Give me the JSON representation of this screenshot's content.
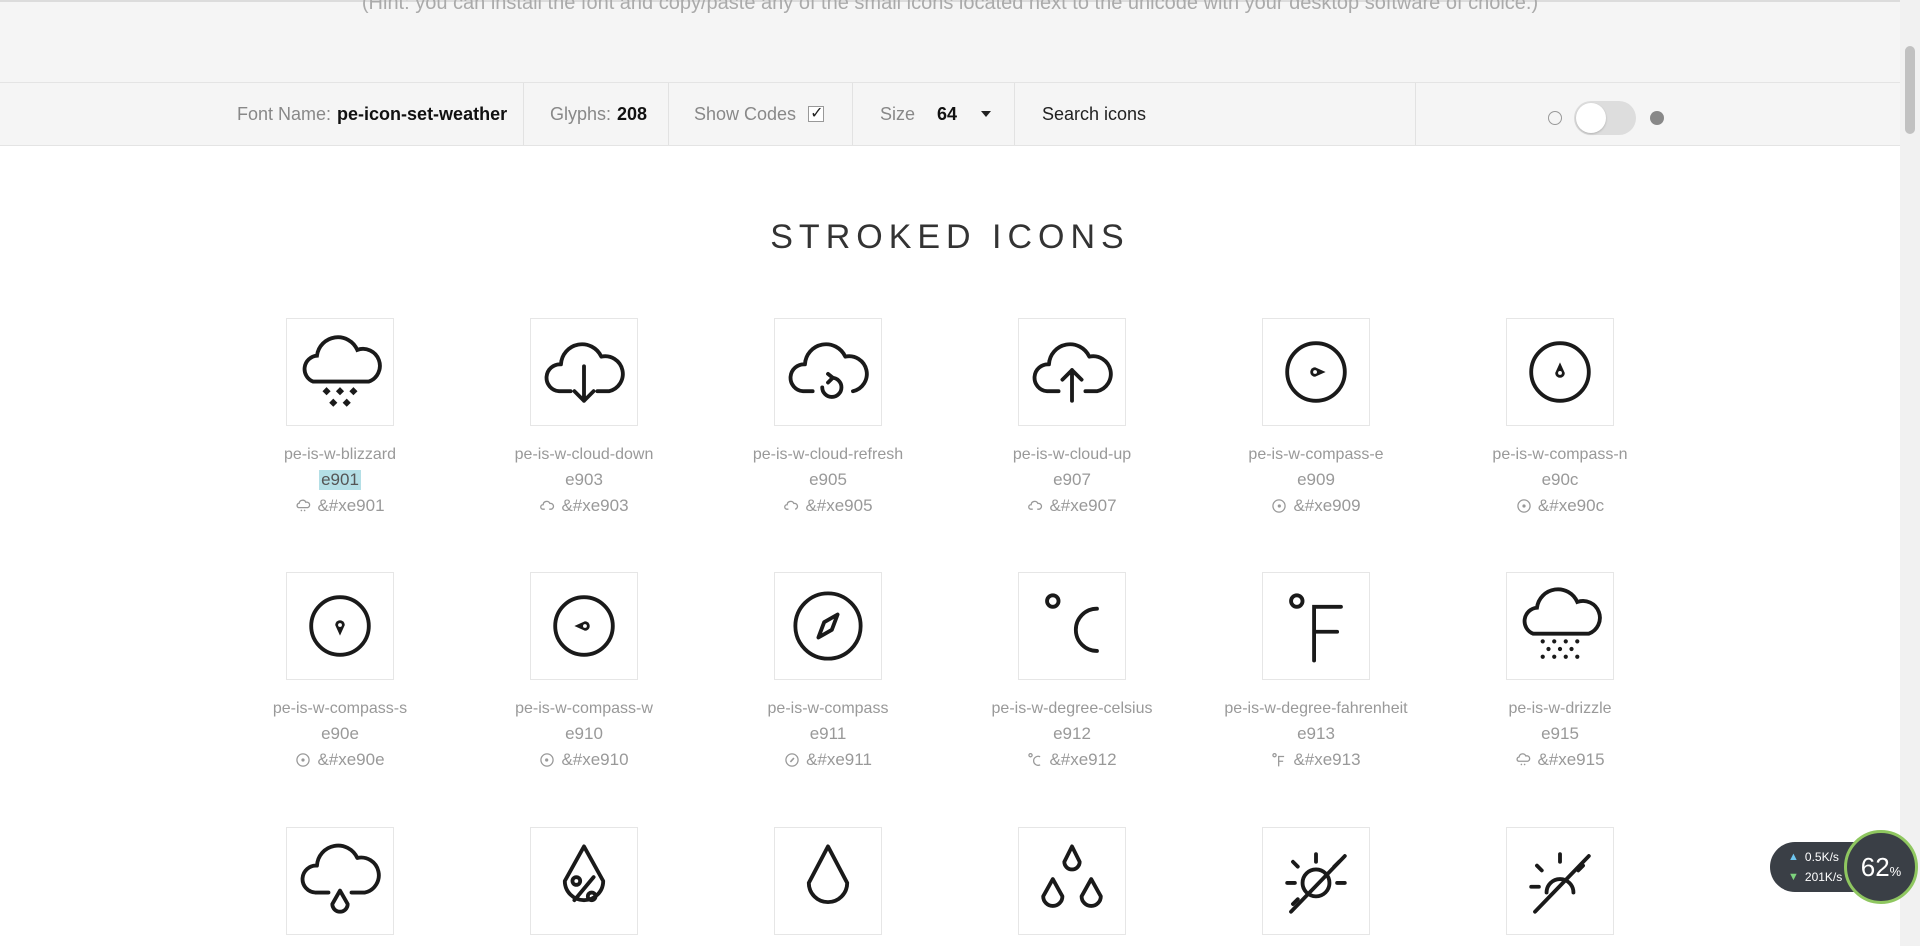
{
  "hint": "(Hint: you can install the font and copy/paste any of the small icons located next to the unicode with your desktop software of choice.)",
  "toolbar": {
    "font_name_label": "Font Name:",
    "font_name_value": "pe-icon-set-weather",
    "glyphs_label": "Glyphs:",
    "glyphs_value": "208",
    "show_codes_label": "Show Codes",
    "show_codes_checked": true,
    "size_label": "Size",
    "size_value": "64",
    "search_placeholder": "Search icons"
  },
  "section_title": "STROKED ICONS",
  "icons": [
    {
      "name": "pe-is-w-blizzard",
      "code": "e901",
      "entity": "&#xe901",
      "icon": "blizzard-icon",
      "selected": true
    },
    {
      "name": "pe-is-w-cloud-down",
      "code": "e903",
      "entity": "&#xe903",
      "icon": "cloud-down-icon"
    },
    {
      "name": "pe-is-w-cloud-refresh",
      "code": "e905",
      "entity": "&#xe905",
      "icon": "cloud-refresh-icon"
    },
    {
      "name": "pe-is-w-cloud-up",
      "code": "e907",
      "entity": "&#xe907",
      "icon": "cloud-up-icon"
    },
    {
      "name": "pe-is-w-compass-e",
      "code": "e909",
      "entity": "&#xe909",
      "icon": "compass-e-icon"
    },
    {
      "name": "pe-is-w-compass-n",
      "code": "e90c",
      "entity": "&#xe90c",
      "icon": "compass-n-icon"
    },
    {
      "name": "pe-is-w-compass-s",
      "code": "e90e",
      "entity": "&#xe90e",
      "icon": "compass-s-icon"
    },
    {
      "name": "pe-is-w-compass-w",
      "code": "e910",
      "entity": "&#xe910",
      "icon": "compass-w-icon"
    },
    {
      "name": "pe-is-w-compass",
      "code": "e911",
      "entity": "&#xe911",
      "icon": "compass-icon"
    },
    {
      "name": "pe-is-w-degree-celsius",
      "code": "e912",
      "entity": "&#xe912",
      "icon": "degree-celsius-icon"
    },
    {
      "name": "pe-is-w-degree-fahrenheit",
      "code": "e913",
      "entity": "&#xe913",
      "icon": "degree-fahrenheit-icon"
    },
    {
      "name": "pe-is-w-drizzle",
      "code": "e915",
      "entity": "&#xe915",
      "icon": "drizzle-icon"
    }
  ],
  "partial_row_icons": [
    "cloud-drop-icon",
    "humidity-icon",
    "drop-icon",
    "drops-icon",
    "sun-off-icon",
    "sunset-off-icon"
  ],
  "network_monitor": {
    "up": "0.5K/s",
    "down": "201K/s",
    "percent": "62",
    "percent_sign": "%"
  }
}
